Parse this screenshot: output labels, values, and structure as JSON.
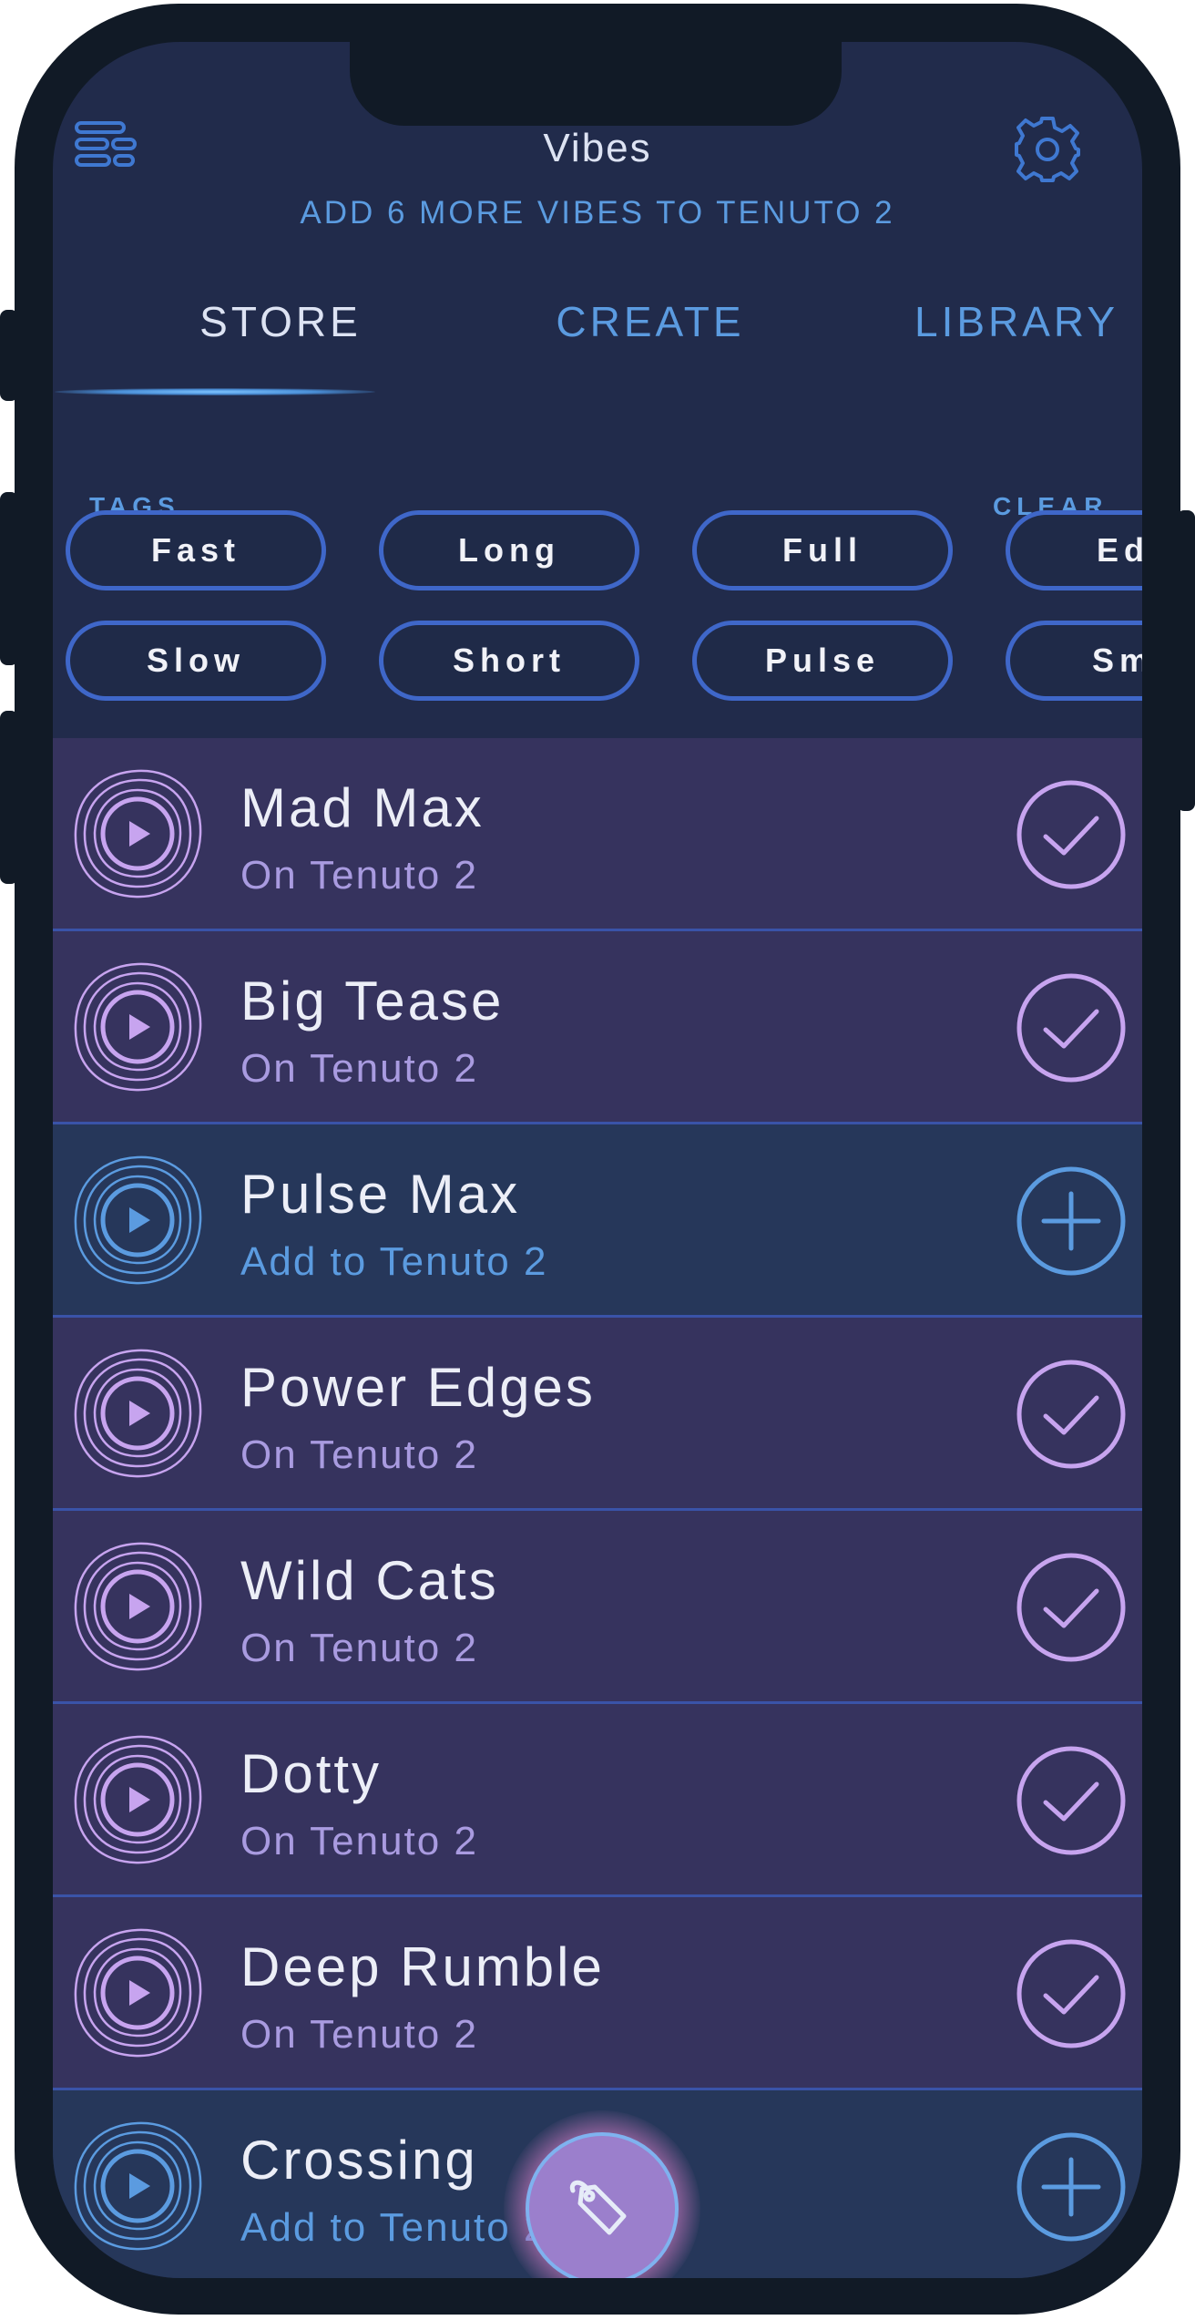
{
  "header": {
    "title": "Vibes",
    "subtitle": "ADD 6 MORE VIBES TO TENUTO 2"
  },
  "tabs": [
    {
      "label": "STORE",
      "active": true
    },
    {
      "label": "CREATE",
      "active": false
    },
    {
      "label": "LIBRARY",
      "active": false
    }
  ],
  "tags": {
    "label": "TAGS",
    "clear_label": "CLEAR",
    "row1": [
      "Fast",
      "Long",
      "Full",
      "Edg"
    ],
    "row2": [
      "Slow",
      "Short",
      "Pulse",
      "Smo"
    ]
  },
  "vibes": [
    {
      "title": "Mad Max",
      "subtitle": "On Tenuto 2",
      "state": "on"
    },
    {
      "title": "Big Tease",
      "subtitle": "On Tenuto 2",
      "state": "on"
    },
    {
      "title": "Pulse Max",
      "subtitle": "Add to Tenuto 2",
      "state": "add"
    },
    {
      "title": "Power Edges",
      "subtitle": "On Tenuto 2",
      "state": "on"
    },
    {
      "title": "Wild Cats",
      "subtitle": "On Tenuto 2",
      "state": "on"
    },
    {
      "title": "Dotty",
      "subtitle": "On Tenuto 2",
      "state": "on"
    },
    {
      "title": "Deep Rumble",
      "subtitle": "On Tenuto 2",
      "state": "on"
    },
    {
      "title": "Crossing",
      "subtitle": "Add to Tenuto 2",
      "state": "add"
    }
  ],
  "icons": {
    "menu": "menu-lines-icon",
    "settings": "gear-icon",
    "play": "play-icon",
    "check": "check-circle-icon",
    "add": "plus-circle-icon",
    "tag": "tag-icon"
  },
  "colors": {
    "background": "#212b4b",
    "accent_blue": "#5b9be0",
    "accent_purple": "#c7a4ef",
    "row_on": "#36335e",
    "row_add": "#26375a"
  }
}
